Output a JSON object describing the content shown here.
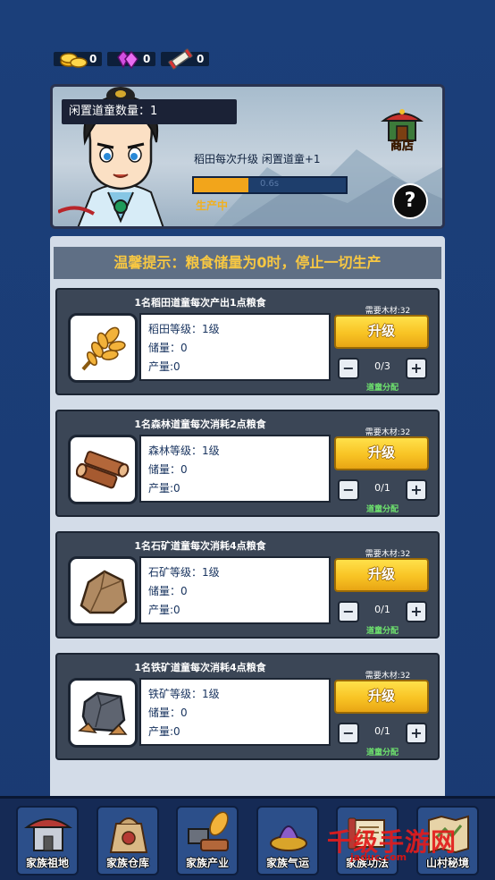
{
  "currency": [
    {
      "icon": "gold-coins-icon",
      "value": "0"
    },
    {
      "icon": "gem-icon",
      "value": "0"
    },
    {
      "icon": "scroll-icon",
      "value": "0"
    }
  ],
  "top_panel": {
    "idle_label": "闲置道童数量：1",
    "upgrade_info": "稻田每次升级 闲置道童+1",
    "progress": 0.36,
    "progress_text": "0.6s",
    "status": "生产中",
    "shop_label": "商店",
    "help_label": "?"
  },
  "tip": "温馨提示：粮食储量为0时，停止一切生产",
  "cards": [
    {
      "title": "1名稻田道童每次产出1点粮食",
      "level": "稻田等级：1级",
      "storage": "储量：0",
      "output": "产量:0",
      "req": "需要木材:32",
      "upgrade": "升级",
      "alloc": "0/3",
      "assign": "道童分配",
      "icon": "wheat-icon"
    },
    {
      "title": "1名森林道童每次消耗2点粮食",
      "level": "森林等级：1级",
      "storage": "储量：0",
      "output": "产量:0",
      "req": "需要木材:32",
      "upgrade": "升级",
      "alloc": "0/1",
      "assign": "道童分配",
      "icon": "wood-log-icon"
    },
    {
      "title": "1名石矿道童每次消耗4点粮食",
      "level": "石矿等级：1级",
      "storage": "储量：0",
      "output": "产量:0",
      "req": "需要木材:32",
      "upgrade": "升级",
      "alloc": "0/1",
      "assign": "道童分配",
      "icon": "stone-icon"
    },
    {
      "title": "1名铁矿道童每次消耗4点粮食",
      "level": "铁矿等级：1级",
      "storage": "储量：0",
      "output": "产量:0",
      "req": "需要木材:32",
      "upgrade": "升级",
      "alloc": "0/1",
      "assign": "道童分配",
      "icon": "iron-ore-icon"
    }
  ],
  "nav": [
    {
      "label": "家族祖地",
      "icon": "ancestral-hall-icon"
    },
    {
      "label": "家族仓库",
      "icon": "warehouse-bag-icon"
    },
    {
      "label": "家族产业",
      "icon": "industry-icon"
    },
    {
      "label": "家族气运",
      "icon": "fortune-icon"
    },
    {
      "label": "家族功法",
      "icon": "scroll-icon"
    },
    {
      "label": "山村秘境",
      "icon": "map-icon"
    }
  ],
  "watermark": {
    "text": "千级手游网",
    "url": "jaduc.com"
  },
  "colors": {
    "accent_yellow": "#f8c324",
    "panel_dark": "#3b4656",
    "tip_text": "#f7c742",
    "assign_green": "#6ee36e"
  }
}
